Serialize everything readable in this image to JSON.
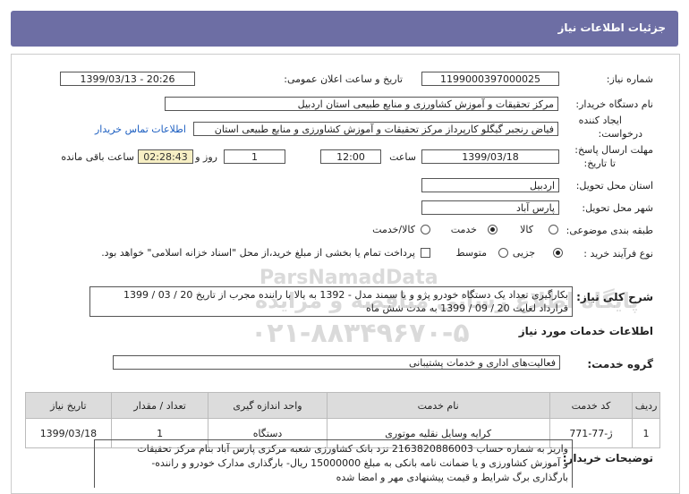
{
  "header": {
    "title": "جزئیات اطلاعات نیاز"
  },
  "fields": {
    "need_number_label": "شماره نیاز:",
    "need_number": "1199000397000025",
    "announce_label": "تاریخ و ساعت اعلان عمومی:",
    "announce_value": "1399/03/13 - 20:26",
    "buyer_org_label": "نام دستگاه خریدار:",
    "buyer_org": "مرکز تحقیقات و آموزش کشاورزی و منابع طبیعی استان اردبیل",
    "creator_label_1": "ایجاد کننده",
    "creator_label_2": "درخواست:",
    "creator": "فیاض رنجبر گیگلو کارپرداز مرکز تحقیقات و آموزش کشاورزی و منابع طبیعی استان",
    "contact_link": "اطلاعات تماس خریدار",
    "deadline_label_1": "مهلت ارسال پاسخ:",
    "deadline_label_2": "تا تاریخ:",
    "deadline_date": "1399/03/18",
    "time_label": "ساعت",
    "deadline_time": "12:00",
    "days_value": "1",
    "days_label": "روز و",
    "remaining_time": "02:28:43",
    "remaining_label": "ساعت باقی مانده",
    "province_label": "استان محل تحویل:",
    "province": "اردبیل",
    "city_label": "شهر محل تحویل:",
    "city": "پارس آباد",
    "category_label": "طبقه بندی موضوعی:",
    "category_options": [
      "کالا",
      "خدمت",
      "کالا/خدمت"
    ],
    "category_selected": "خدمت",
    "process_label": "نوع فرآیند خرید :",
    "process_options": [
      "جزیی",
      "متوسط"
    ],
    "process_selected": "جزیی",
    "process_note": "پرداخت تمام یا بخشی از مبلغ خرید،از محل \"اسناد خزانه اسلامی\" خواهد بود."
  },
  "description": {
    "label": "شرح کلی نیاز:",
    "line1": "بکارگیری تعداد یک دستگاه خودرو پژو و یا سمند مدل - 1392 به بالا با راننده مجرب از تاریخ 20 / 03 / 1399",
    "line2": "قرارداد لغایت 20 / 09 / 1399 به مدت شش ماه"
  },
  "services": {
    "section_title": "اطلاعات خدمات مورد نیاز",
    "group_label": "گروه خدمت:",
    "group_value": "فعالیت‌های اداری و خدمات پشتیبانی",
    "table": {
      "headers": [
        "ردیف",
        "کد خدمت",
        "نام خدمت",
        "واحد اندازه گیری",
        "تعداد / مقدار",
        "تاریخ نیاز"
      ],
      "rows": [
        [
          "1",
          "ژ-77-771",
          "کرایه وسایل نقلیه موتوری",
          "دستگاه",
          "1",
          "1399/03/18"
        ]
      ]
    }
  },
  "buyer_notes": {
    "label": "توضیحات خریدار:",
    "line1": "واریز به شماره حساب 2163820886003 نزد بانک کشاورزی شعبه مرکزی پارس آباد بنام  مرکز تحقیقات",
    "line2": "و آموزش کشاورزی و یا ضمانت نامه بانکی به مبلغ 15000000 ریال- بارگذاری مدارک خودرو و راننده-",
    "line3": "بارگذاری برگ شرایط و قیمت پیشنهادی مهر و امضا شده"
  },
  "watermark": {
    "brand": "ParsNamadData",
    "line1": "پایگاه اطلاع رسانی مناقصه و مزایده",
    "line2": "۰۲۱-۸۸۳۴۹۶۷۰-۵"
  }
}
